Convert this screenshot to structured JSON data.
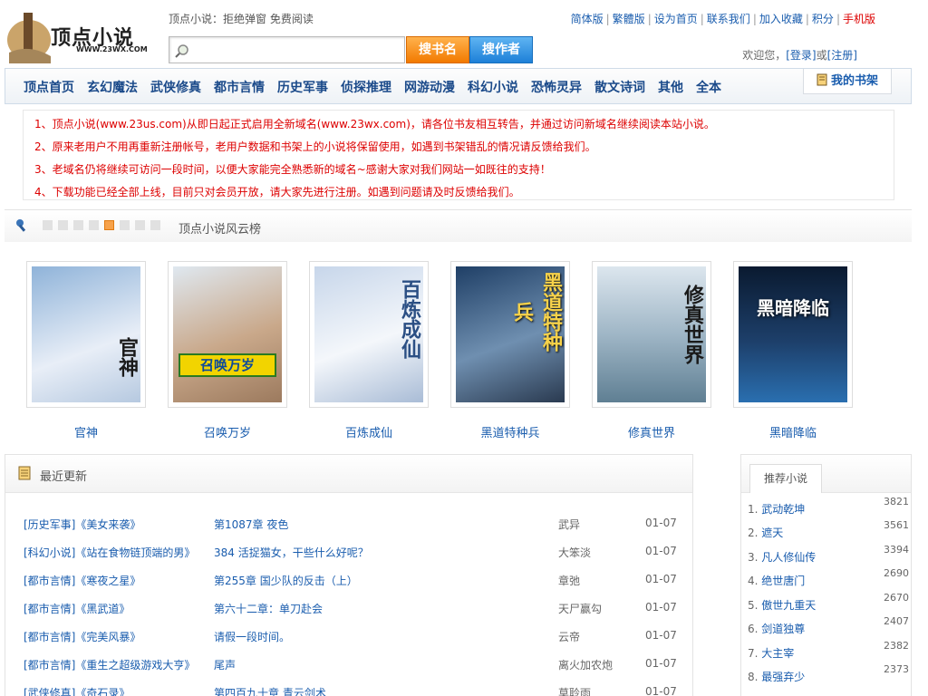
{
  "header": {
    "logo_text": "顶点小说",
    "logo_url_text": "WWW.23WX.COM",
    "slogan": "顶点小说：拒绝弹窗 免费阅读",
    "search_placeholder": "",
    "search_book_label": "搜书名",
    "search_author_label": "搜作者",
    "toplinks": [
      "简体版",
      "繁體版",
      "设为首页",
      "联系我们",
      "加入收藏",
      "积分",
      "手机版"
    ],
    "welcome_prefix": "欢迎您，",
    "login_label": "[登录]",
    "or_label": "或",
    "register_label": "[注册]"
  },
  "nav": {
    "items": [
      "顶点首页",
      "玄幻魔法",
      "武侠修真",
      "都市言情",
      "历史军事",
      "侦探推理",
      "网游动漫",
      "科幻小说",
      "恐怖灵异",
      "散文诗词",
      "其他",
      "全本"
    ],
    "shelf_label": "我的书架"
  },
  "notices": [
    "1、顶点小说(www.23us.com)从即日起正式启用全新域名(www.23wx.com)，请各位书友相互转告，并通过访问新域名继续阅读本站小说。",
    "2、原来老用户不用再重新注册帐号，老用户数据和书架上的小说将保留使用，如遇到书架错乱的情况请反馈给我们。",
    "3、老域名仍将继续可访问一段时间，以便大家能完全熟悉新的域名~感谢大家对我们网站一如既往的支持！",
    "4、下载功能已经全部上线，目前只对会员开放，请大家先进行注册。如遇到问题请及时反馈给我们。"
  ],
  "rank": {
    "title": "顶点小说风云榜",
    "books": [
      {
        "name": "官神",
        "color_a": "#8fb3d9",
        "color_b": "#e8eef7"
      },
      {
        "name": "召唤万岁",
        "color_a": "#dfe8f0",
        "color_b": "#9c7a5e"
      },
      {
        "name": "百炼成仙",
        "color_a": "#c7d6ea",
        "color_b": "#f4f7fb"
      },
      {
        "name": "黑道特种兵",
        "color_a": "#1f3f66",
        "color_b": "#6f8fb0"
      },
      {
        "name": "修真世界",
        "color_a": "#dce6ee",
        "color_b": "#5f7f93"
      },
      {
        "name": "黑暗降临",
        "color_a": "#0a1a30",
        "color_b": "#2a6fb0"
      }
    ]
  },
  "latest": {
    "title": "最近更新",
    "rows": [
      {
        "book": "[历史军事]《美女来袭》",
        "chapter": "第1087章 夜色",
        "author": "武异",
        "date": "01-07"
      },
      {
        "book": "[科幻小说]《站在食物链顶端的男》",
        "chapter": "384 活捉猫女，干些什么好呢？",
        "author": "大笨淡",
        "date": "01-07"
      },
      {
        "book": "[都市言情]《寒夜之星》",
        "chapter": "第255章 国少队的反击（上）",
        "author": "章弛",
        "date": "01-07"
      },
      {
        "book": "[都市言情]《黑武道》",
        "chapter": "第六十二章：单刀赴会",
        "author": "天尸赢勾",
        "date": "01-07"
      },
      {
        "book": "[都市言情]《完美风暴》",
        "chapter": "请假一段时间。",
        "author": "云帝",
        "date": "01-07"
      },
      {
        "book": "[都市言情]《重生之超级游戏大亨》",
        "chapter": "尾声",
        "author": "离火加农炮",
        "date": "01-07"
      },
      {
        "book": "[武侠修真]《奇石录》",
        "chapter": "第四百九十章 青云剑术",
        "author": "莫聆雨",
        "date": "01-07"
      }
    ]
  },
  "recommend": {
    "title": "推荐小说",
    "items": [
      {
        "rank": "1.",
        "name": "武动乾坤",
        "count": "3821"
      },
      {
        "rank": "2.",
        "name": "遮天",
        "count": "3561"
      },
      {
        "rank": "3.",
        "name": "凡人修仙传",
        "count": "3394"
      },
      {
        "rank": "4.",
        "name": "绝世唐门",
        "count": "2690"
      },
      {
        "rank": "5.",
        "name": "傲世九重天",
        "count": "2670"
      },
      {
        "rank": "6.",
        "name": "剑道独尊",
        "count": "2407"
      },
      {
        "rank": "7.",
        "name": "大主宰",
        "count": "2382"
      },
      {
        "rank": "8.",
        "name": "最强弃少",
        "count": "2373"
      }
    ]
  }
}
